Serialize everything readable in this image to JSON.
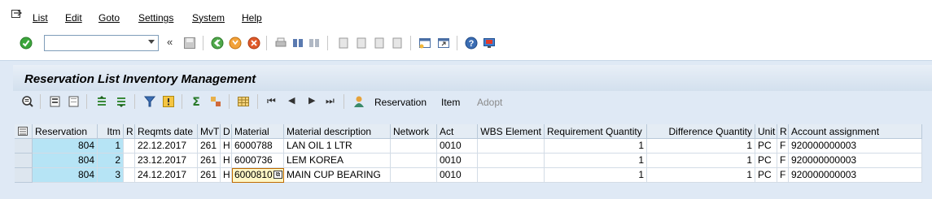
{
  "menu": {
    "items": [
      "List",
      "Edit",
      "Goto",
      "Settings",
      "System",
      "Help"
    ]
  },
  "system_toolbar": {
    "command_field_value": "",
    "icons": [
      "enter-icon",
      "back-arrows-icon",
      "save-icon",
      "back-icon",
      "exit-icon",
      "cancel-icon",
      "print-icon",
      "find-icon",
      "find-next-icon",
      "first-page-icon",
      "prev-page-icon",
      "next-page-icon",
      "last-page-icon",
      "new-session-icon",
      "shortcut-icon",
      "help-icon",
      "layout-icon"
    ]
  },
  "screen": {
    "title": "Reservation List Inventory Management"
  },
  "app_toolbar": {
    "reservation_label": "Reservation",
    "item_label": "Item",
    "adopt_label": "Adopt"
  },
  "table": {
    "headers": [
      "Reservation",
      "Itm",
      "R",
      "Reqmts date",
      "MvT",
      "D",
      "Material",
      "Material description",
      "Network",
      "Act",
      "WBS Element",
      "Requirement Quantity",
      "Difference Quantity",
      "Unit",
      "R",
      "Account assignment"
    ],
    "rows": [
      [
        "804",
        "1",
        "",
        "22.12.2017",
        "261",
        "H",
        "6000788",
        "LAN OIL 1 LTR",
        "",
        "0010",
        "",
        "1",
        "1",
        "PC",
        "F",
        "920000000003"
      ],
      [
        "804",
        "2",
        "",
        "23.12.2017",
        "261",
        "H",
        "6000736",
        "LEM KOREA",
        "",
        "0010",
        "",
        "1",
        "1",
        "PC",
        "F",
        "920000000003"
      ],
      [
        "804",
        "3",
        "",
        "24.12.2017",
        "261",
        "H",
        "6000810",
        "MAIN CUP BEARING",
        "",
        "0010",
        "",
        "1",
        "1",
        "PC",
        "F",
        "920000000003"
      ]
    ]
  },
  "colors": {
    "app_background": "#dfe9f5",
    "key_cell": "#b6e4f5",
    "header_cell": "#e4ecf4"
  }
}
